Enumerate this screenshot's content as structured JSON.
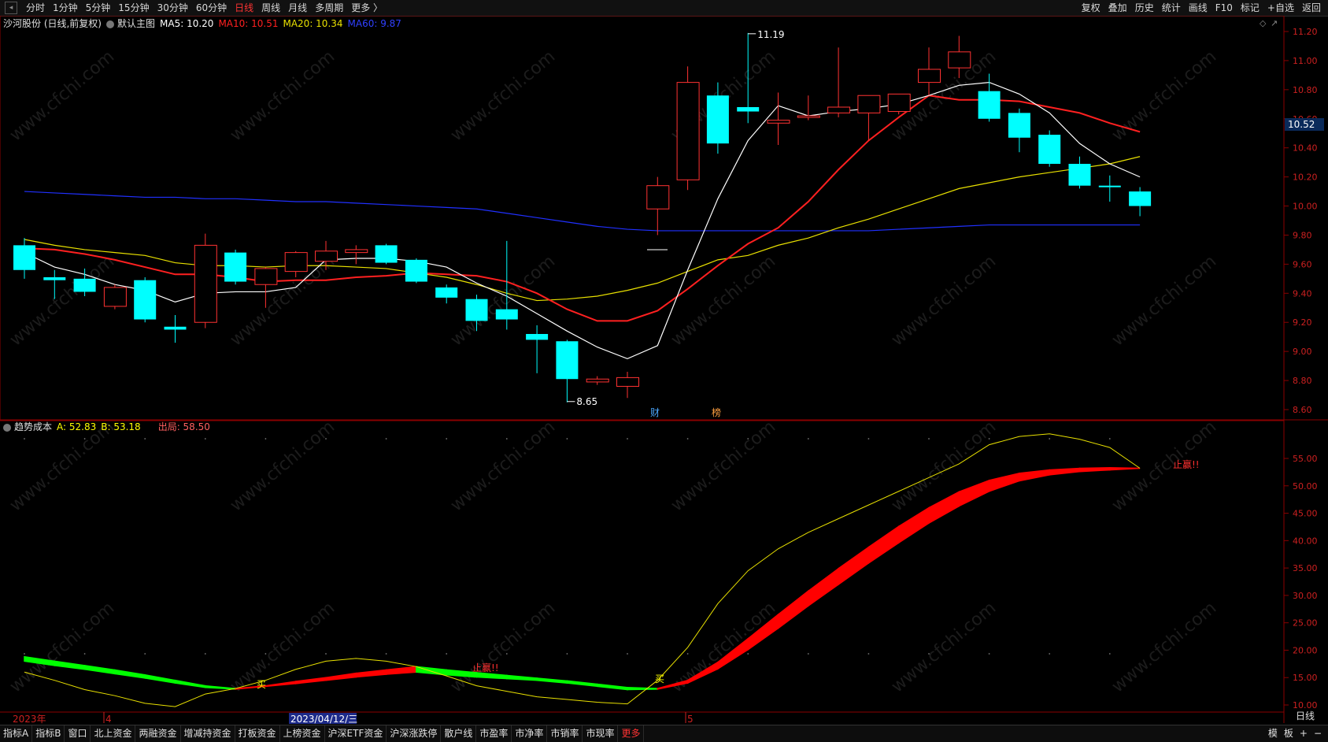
{
  "topbar": {
    "periods": [
      "分时",
      "1分钟",
      "5分钟",
      "15分钟",
      "30分钟",
      "60分钟",
      "日线",
      "周线",
      "月线",
      "多周期",
      "更多 〉"
    ],
    "active_period": "日线",
    "right_buttons": [
      "复权",
      "叠加",
      "历史",
      "统计",
      "画线",
      "F10",
      "标记",
      "+自选",
      "返回"
    ]
  },
  "main_pane": {
    "stock_title": "沙河股份 (日线,前复权)",
    "template_label": "默认主图",
    "ma5_label": "MA5: 10.20",
    "ma10_label": "MA10: 10.51",
    "ma20_label": "MA20: 10.34",
    "ma60_label": "MA60: 9.87",
    "high_label": "11.19",
    "low_label": "8.65",
    "current_price": "10.52",
    "event_fin": "财",
    "event_list": "榜",
    "y_ticks": [
      "11.20",
      "11.00",
      "10.80",
      "10.60",
      "10.40",
      "10.20",
      "10.00",
      "9.80",
      "9.60",
      "9.40",
      "9.20",
      "9.00",
      "8.80",
      "8.60"
    ]
  },
  "indicator_pane": {
    "name": "趋势成本",
    "a_label": "A: 52.83",
    "b_label": "B: 53.18",
    "exit_label": "出局: 58.50",
    "buy_marker": "买",
    "stop_marker": "止赢!!",
    "y_ticks": [
      "55.00",
      "50.00",
      "45.00",
      "40.00",
      "35.00",
      "30.00",
      "25.00",
      "20.00",
      "15.00",
      "10.00"
    ]
  },
  "x_axis": {
    "year_label": "2023年",
    "month4_label": "4",
    "date_label": "2023/04/12/三",
    "month5_label": "5",
    "period_label": "日线"
  },
  "bottombar": {
    "tabs": [
      "指标A",
      "指标B",
      "窗口",
      "北上资金",
      "两融资金",
      "增减持资金",
      "打板资金",
      "上榜资金",
      "沪深ETF资金",
      "沪深涨跌停",
      "散户线",
      "市盈率",
      "市净率",
      "市销率",
      "市现率",
      "更多"
    ],
    "active_tab": "更多",
    "right_items": [
      "模",
      "板",
      "+",
      "−"
    ]
  },
  "colors": {
    "up": "#ff3232",
    "down": "#00ffff",
    "ma5": "#ffffff",
    "ma10": "#ff2020",
    "ma20": "#e8e000",
    "ma60": "#2030ff",
    "grid": "#8b0000"
  },
  "chart_data": [
    {
      "type": "candlestick",
      "name": "沙河股份",
      "ylim": [
        8.55,
        11.25
      ],
      "candles": [
        {
          "o": 9.73,
          "h": 9.78,
          "l": 9.5,
          "c": 9.56
        },
        {
          "o": 9.51,
          "h": 9.56,
          "l": 9.36,
          "c": 9.49
        },
        {
          "o": 9.5,
          "h": 9.57,
          "l": 9.38,
          "c": 9.41
        },
        {
          "o": 9.31,
          "h": 9.46,
          "l": 9.29,
          "c": 9.44
        },
        {
          "o": 9.49,
          "h": 9.51,
          "l": 9.2,
          "c": 9.22
        },
        {
          "o": 9.17,
          "h": 9.25,
          "l": 9.06,
          "c": 9.15
        },
        {
          "o": 9.2,
          "h": 9.81,
          "l": 9.16,
          "c": 9.73
        },
        {
          "o": 9.68,
          "h": 9.7,
          "l": 9.46,
          "c": 9.48
        },
        {
          "o": 9.46,
          "h": 9.58,
          "l": 9.3,
          "c": 9.57
        },
        {
          "o": 9.55,
          "h": 9.69,
          "l": 9.51,
          "c": 9.68
        },
        {
          "o": 9.62,
          "h": 9.76,
          "l": 9.56,
          "c": 9.69
        },
        {
          "o": 9.68,
          "h": 9.73,
          "l": 9.6,
          "c": 9.7
        },
        {
          "o": 9.73,
          "h": 9.74,
          "l": 9.6,
          "c": 9.61
        },
        {
          "o": 9.63,
          "h": 9.64,
          "l": 9.47,
          "c": 9.48
        },
        {
          "o": 9.44,
          "h": 9.46,
          "l": 9.33,
          "c": 9.37
        },
        {
          "o": 9.36,
          "h": 9.39,
          "l": 9.14,
          "c": 9.21
        },
        {
          "o": 9.29,
          "h": 9.76,
          "l": 9.15,
          "c": 9.22
        },
        {
          "o": 9.12,
          "h": 9.18,
          "l": 8.85,
          "c": 9.08
        },
        {
          "o": 9.07,
          "h": 9.08,
          "l": 8.65,
          "c": 8.81
        },
        {
          "o": 8.79,
          "h": 8.83,
          "l": 8.77,
          "c": 8.81
        },
        {
          "o": 8.76,
          "h": 8.86,
          "l": 8.68,
          "c": 8.82
        },
        {
          "o": 9.98,
          "h": 10.2,
          "l": 9.8,
          "c": 10.14
        },
        {
          "o": 10.18,
          "h": 10.96,
          "l": 10.11,
          "c": 10.85
        },
        {
          "o": 10.76,
          "h": 10.85,
          "l": 10.36,
          "c": 10.43
        },
        {
          "o": 10.68,
          "h": 11.19,
          "l": 10.57,
          "c": 10.65
        },
        {
          "o": 10.57,
          "h": 10.78,
          "l": 10.42,
          "c": 10.59
        },
        {
          "o": 10.61,
          "h": 10.76,
          "l": 10.59,
          "c": 10.62
        },
        {
          "o": 10.64,
          "h": 11.09,
          "l": 10.61,
          "c": 10.68
        },
        {
          "o": 10.64,
          "h": 10.74,
          "l": 10.45,
          "c": 10.76
        },
        {
          "o": 10.65,
          "h": 10.76,
          "l": 10.63,
          "c": 10.77
        },
        {
          "o": 10.85,
          "h": 11.09,
          "l": 10.76,
          "c": 10.94
        },
        {
          "o": 10.95,
          "h": 11.17,
          "l": 10.88,
          "c": 11.06
        },
        {
          "o": 10.79,
          "h": 10.91,
          "l": 10.58,
          "c": 10.6
        },
        {
          "o": 10.64,
          "h": 10.67,
          "l": 10.37,
          "c": 10.47
        },
        {
          "o": 10.49,
          "h": 10.52,
          "l": 10.27,
          "c": 10.29
        },
        {
          "o": 10.29,
          "h": 10.34,
          "l": 10.12,
          "c": 10.14
        },
        {
          "o": 10.14,
          "h": 10.21,
          "l": 10.03,
          "c": 10.13
        },
        {
          "o": 10.1,
          "h": 10.13,
          "l": 9.93,
          "c": 10.0
        }
      ],
      "ma5": [
        9.68,
        9.58,
        9.53,
        9.46,
        9.42,
        9.34,
        9.4,
        9.41,
        9.41,
        9.44,
        9.63,
        9.64,
        9.64,
        9.62,
        9.58,
        9.47,
        9.38,
        9.26,
        9.14,
        9.03,
        8.95,
        9.04,
        9.56,
        10.05,
        10.45,
        10.69,
        10.62,
        10.65,
        10.67,
        10.7,
        10.76,
        10.83,
        10.85,
        10.77,
        10.64,
        10.43,
        10.29,
        10.2
      ],
      "ma10": [
        9.71,
        9.7,
        9.67,
        9.63,
        9.58,
        9.53,
        9.53,
        9.51,
        9.48,
        9.49,
        9.49,
        9.51,
        9.52,
        9.54,
        9.53,
        9.52,
        9.48,
        9.4,
        9.29,
        9.21,
        9.21,
        9.28,
        9.43,
        9.59,
        9.74,
        9.85,
        10.03,
        10.25,
        10.45,
        10.61,
        10.76,
        10.73,
        10.73,
        10.72,
        10.68,
        10.64,
        10.57,
        10.51
      ],
      "ma20": [
        9.77,
        9.73,
        9.7,
        9.68,
        9.66,
        9.61,
        9.59,
        9.59,
        9.58,
        9.59,
        9.59,
        9.58,
        9.57,
        9.54,
        9.51,
        9.46,
        9.4,
        9.35,
        9.36,
        9.38,
        9.42,
        9.47,
        9.55,
        9.63,
        9.66,
        9.73,
        9.78,
        9.85,
        9.91,
        9.98,
        10.05,
        10.12,
        10.16,
        10.2,
        10.23,
        10.26,
        10.29,
        10.34
      ],
      "ma60": [
        10.1,
        10.09,
        10.08,
        10.07,
        10.06,
        10.06,
        10.05,
        10.05,
        10.04,
        10.03,
        10.03,
        10.02,
        10.01,
        10.0,
        9.99,
        9.98,
        9.95,
        9.92,
        9.89,
        9.86,
        9.84,
        9.83,
        9.83,
        9.83,
        9.83,
        9.83,
        9.83,
        9.83,
        9.83,
        9.84,
        9.85,
        9.86,
        9.87,
        9.87,
        9.87,
        9.87,
        9.87,
        9.87
      ]
    },
    {
      "type": "line",
      "name": "趋势成本",
      "ylim": [
        9,
        60
      ],
      "series": [
        {
          "name": "A",
          "values": [
            18.0,
            17.2,
            16.5,
            15.7,
            14.9,
            14.0,
            13.2,
            12.9,
            13.4,
            13.9,
            14.5,
            15.1,
            15.6,
            16.0,
            15.5,
            15.1,
            14.8,
            14.5,
            14.0,
            13.4,
            12.8,
            12.9,
            14.0,
            16.6,
            20.1,
            24.0,
            28.1,
            32.0,
            35.9,
            39.6,
            43.2,
            46.3,
            49.0,
            50.9,
            52.0,
            52.6,
            52.9,
            53.2
          ]
        },
        {
          "name": "B",
          "values": [
            18.8,
            18.0,
            17.2,
            16.4,
            15.5,
            14.5,
            13.5,
            13.0,
            13.5,
            14.3,
            15.0,
            15.8,
            16.4,
            17.0,
            16.4,
            15.9,
            15.4,
            14.9,
            14.4,
            13.8,
            13.2,
            13.0,
            14.5,
            17.8,
            22.1,
            26.5,
            30.8,
            34.9,
            38.8,
            42.6,
            46.0,
            48.9,
            51.0,
            52.3,
            52.9,
            53.2,
            53.3,
            53.2
          ]
        },
        {
          "name": "出局",
          "values": [
            16.0,
            14.5,
            12.8,
            11.7,
            10.3,
            9.7,
            12.0,
            13.0,
            14.5,
            16.5,
            18.0,
            18.5,
            18.0,
            17.0,
            15.3,
            13.5,
            12.5,
            11.5,
            11.0,
            10.5,
            10.2,
            14.5,
            20.5,
            28.5,
            34.5,
            38.5,
            41.5,
            44.0,
            46.5,
            49.0,
            51.5,
            54.0,
            57.5,
            59.0,
            59.5,
            58.5,
            57.0,
            53.2
          ]
        }
      ]
    }
  ]
}
